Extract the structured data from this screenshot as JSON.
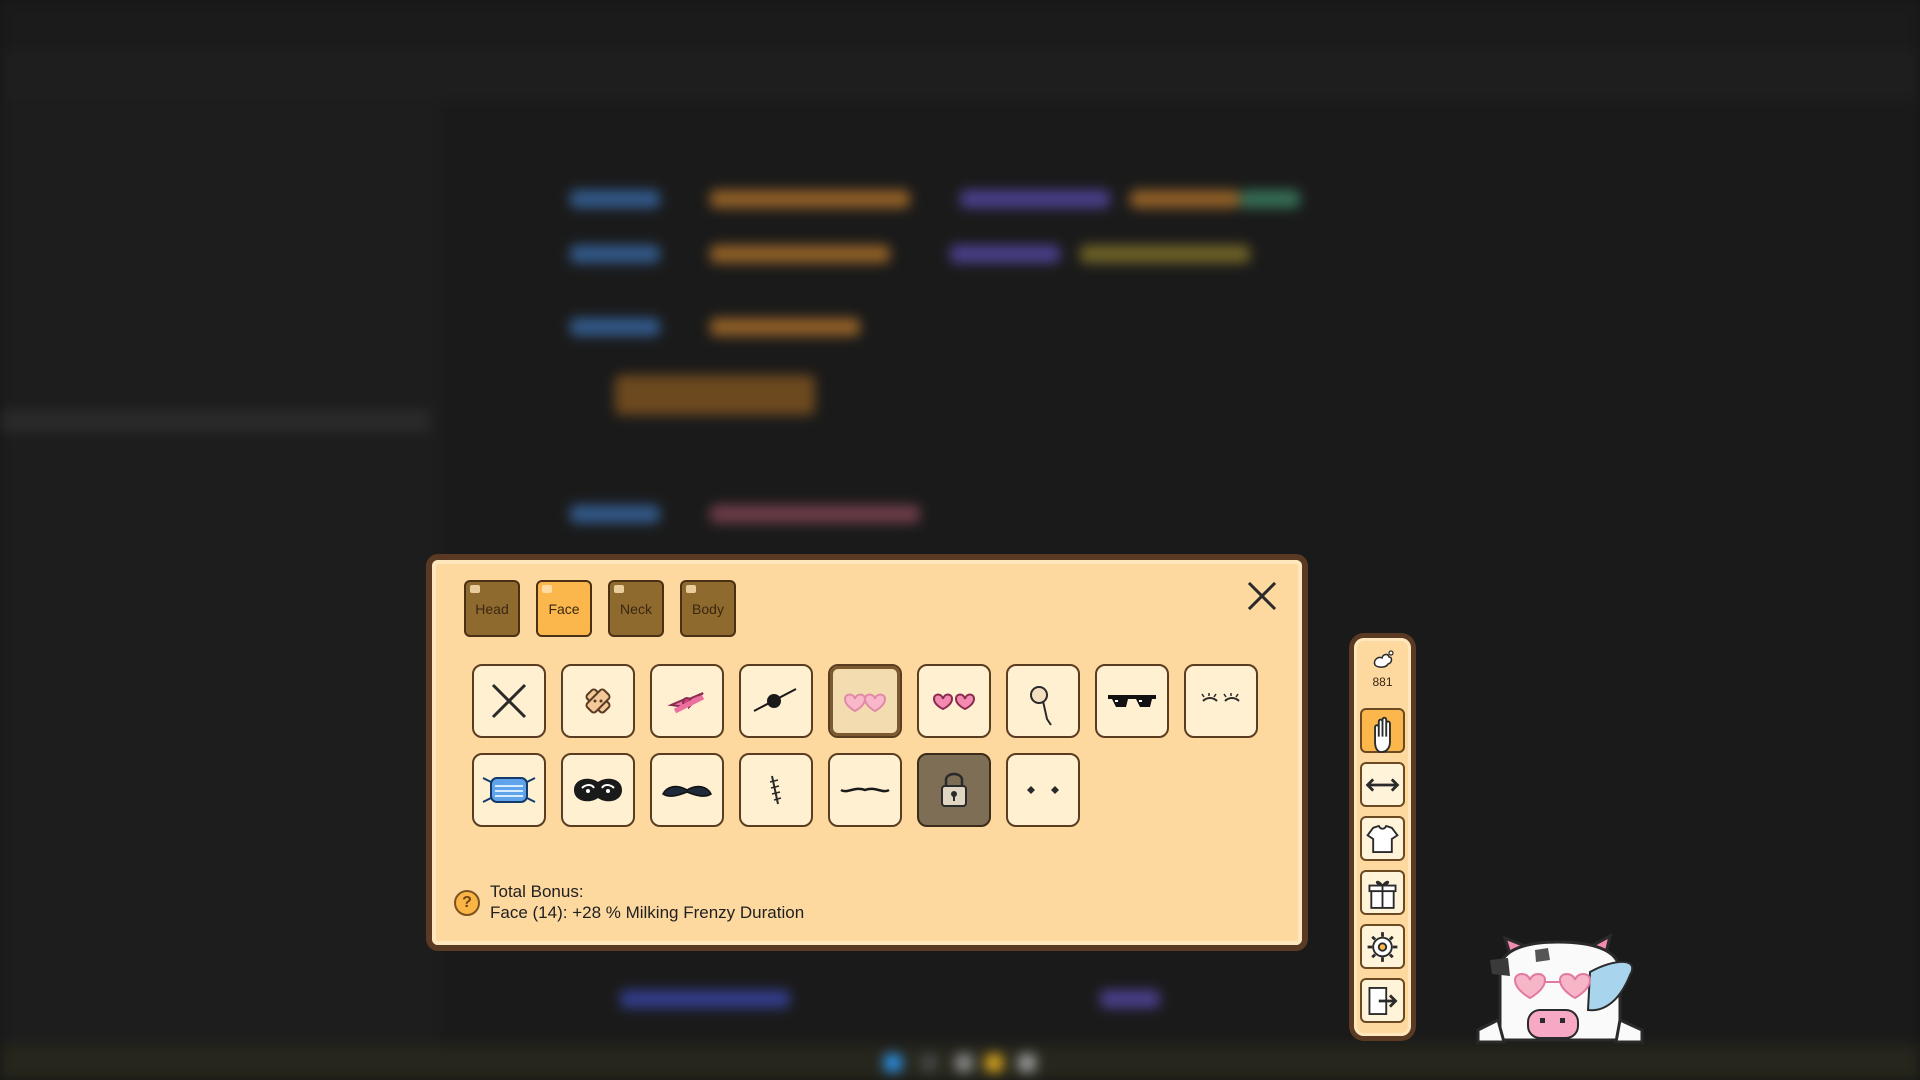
{
  "tabs": [
    {
      "label": "Head",
      "active": false
    },
    {
      "label": "Face",
      "active": true
    },
    {
      "label": "Neck",
      "active": false
    },
    {
      "label": "Body",
      "active": false
    }
  ],
  "items": [
    {
      "name": "none-icon",
      "state": "normal"
    },
    {
      "name": "bandage-icon",
      "state": "normal"
    },
    {
      "name": "pink-bow-icon",
      "state": "normal"
    },
    {
      "name": "eyepatch-icon",
      "state": "normal"
    },
    {
      "name": "pink-heart-glasses-icon",
      "state": "selected"
    },
    {
      "name": "heart-eyes-icon",
      "state": "normal"
    },
    {
      "name": "monocle-icon",
      "state": "normal"
    },
    {
      "name": "pixel-sunglasses-icon",
      "state": "normal"
    },
    {
      "name": "eyelashes-icon",
      "state": "normal"
    },
    {
      "name": "face-mask-icon",
      "state": "normal"
    },
    {
      "name": "sleep-mask-icon",
      "state": "normal"
    },
    {
      "name": "mustache-icon",
      "state": "normal"
    },
    {
      "name": "scar-icon",
      "state": "normal"
    },
    {
      "name": "thin-mustache-icon",
      "state": "normal"
    },
    {
      "name": "lock-icon",
      "state": "locked"
    },
    {
      "name": "dot-eyes-icon",
      "state": "normal"
    }
  ],
  "bonus": {
    "icon": "question-mark-icon",
    "icon_glyph": "?",
    "title": "Total Bonus:",
    "line": "Face (14): +28 % Milking Frenzy Duration"
  },
  "sidebar": {
    "count": "881",
    "count_icon": "milk-splash-icon",
    "buttons": [
      {
        "name": "hand-wave-icon",
        "active": true
      },
      {
        "name": "resize-arrows-icon",
        "active": false
      },
      {
        "name": "shirt-icon",
        "active": false
      },
      {
        "name": "gift-icon",
        "active": false
      },
      {
        "name": "gear-icon",
        "active": false
      },
      {
        "name": "exit-icon",
        "active": false
      }
    ]
  },
  "colors": {
    "panel": "#fdd9a0",
    "border": "#5a3a22",
    "tab_active": "#fbb74c",
    "tab_inactive": "#8f6a2e"
  }
}
